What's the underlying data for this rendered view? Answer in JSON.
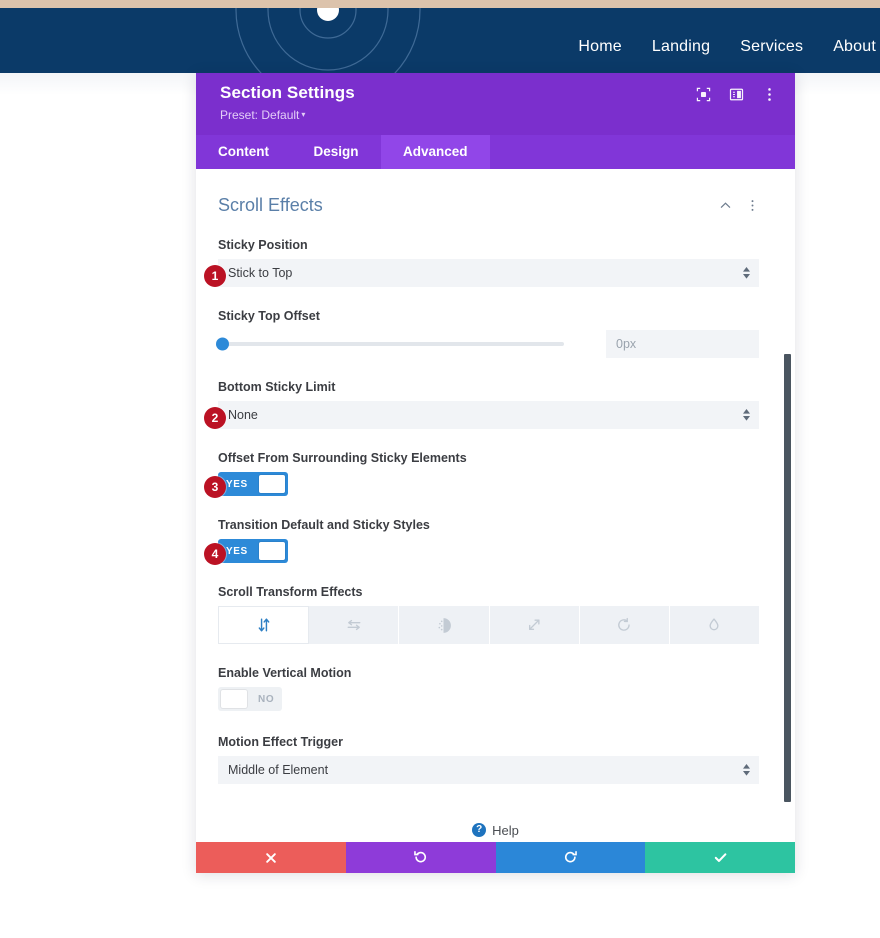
{
  "site": {
    "nav_links": [
      "Home",
      "Landing",
      "Services",
      "About"
    ],
    "strip_color": "#dcc3ac",
    "nav_bg": "#0b3a68"
  },
  "modal": {
    "title": "Section Settings",
    "preset": "Preset: Default",
    "preset_caret": "▾",
    "header_icons": [
      {
        "name": "focus-target-icon"
      },
      {
        "name": "panel-layout-icon"
      },
      {
        "name": "more-vertical-icon"
      }
    ],
    "tabs": [
      {
        "label": "Content",
        "active": false
      },
      {
        "label": "Design",
        "active": false
      },
      {
        "label": "Advanced",
        "active": true
      }
    ],
    "section": {
      "title": "Scroll Effects",
      "collapse_icon": "chevron-up-icon",
      "menu_icon": "more-vertical-icon"
    },
    "fields": {
      "sticky_position": {
        "label": "Sticky Position",
        "value": "Stick to Top",
        "badge": "1"
      },
      "sticky_top_offset": {
        "label": "Sticky Top Offset",
        "value": "0px",
        "slider_percent": 0
      },
      "bottom_sticky_limit": {
        "label": "Bottom Sticky Limit",
        "value": "None",
        "badge": "2"
      },
      "offset_surrounding": {
        "label": "Offset From Surrounding Sticky Elements",
        "toggle": "YES",
        "state": "on",
        "badge": "3"
      },
      "transition_styles": {
        "label": "Transition Default and Sticky Styles",
        "toggle": "YES",
        "state": "on",
        "badge": "4"
      },
      "scroll_transform_effects": {
        "label": "Scroll Transform Effects",
        "options": [
          {
            "name": "vertical-motion-icon",
            "active": true
          },
          {
            "name": "horizontal-motion-icon",
            "active": false
          },
          {
            "name": "fade-icon",
            "active": false
          },
          {
            "name": "scale-icon",
            "active": false
          },
          {
            "name": "rotate-icon",
            "active": false
          },
          {
            "name": "blur-icon",
            "active": false
          }
        ]
      },
      "enable_vertical_motion": {
        "label": "Enable Vertical Motion",
        "toggle": "NO",
        "state": "off"
      },
      "motion_effect_trigger": {
        "label": "Motion Effect Trigger",
        "value": "Middle of Element"
      }
    },
    "help": {
      "label": "Help",
      "icon_glyph": "?"
    },
    "footer": [
      {
        "name": "cancel-button",
        "icon": "close-icon",
        "color": "#ec5d5a"
      },
      {
        "name": "undo-button",
        "icon": "undo-icon",
        "color": "#8e3bd9"
      },
      {
        "name": "redo-button",
        "icon": "redo-icon",
        "color": "#2b87d8"
      },
      {
        "name": "save-button",
        "icon": "check-icon",
        "color": "#2dc4a1"
      }
    ]
  }
}
